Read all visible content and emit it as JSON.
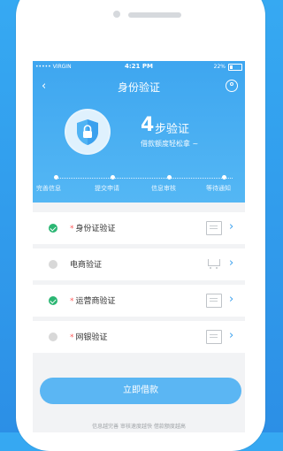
{
  "status_bar": {
    "carrier": "••••• VIRGIN",
    "time": "4:21 PM",
    "battery": "22%",
    "battery_level": 0.22
  },
  "nav": {
    "title": "身份验证"
  },
  "hero": {
    "steps_number": "4",
    "steps_unit": "步验证",
    "slogan": "借款额度轻松拿 ~"
  },
  "progress_steps": [
    "完善信息",
    "提交申请",
    "信息审核",
    "等待通知"
  ],
  "verification_items": [
    {
      "label": "身份证验证",
      "required": true,
      "done": true,
      "icon": "id-card-icon"
    },
    {
      "label": "电商验证",
      "required": false,
      "done": false,
      "icon": "cart-icon"
    },
    {
      "label": "运营商验证",
      "required": true,
      "done": true,
      "icon": "document-icon"
    },
    {
      "label": "网银验证",
      "required": true,
      "done": false,
      "icon": "keyboard-icon"
    }
  ],
  "apply_button": "立即借款",
  "footer": "信息越完善 审核速度越快 借款额度越高",
  "colors": {
    "primary": "#3ea6f0",
    "success": "#2bb673",
    "button": "#5bb6f3"
  }
}
